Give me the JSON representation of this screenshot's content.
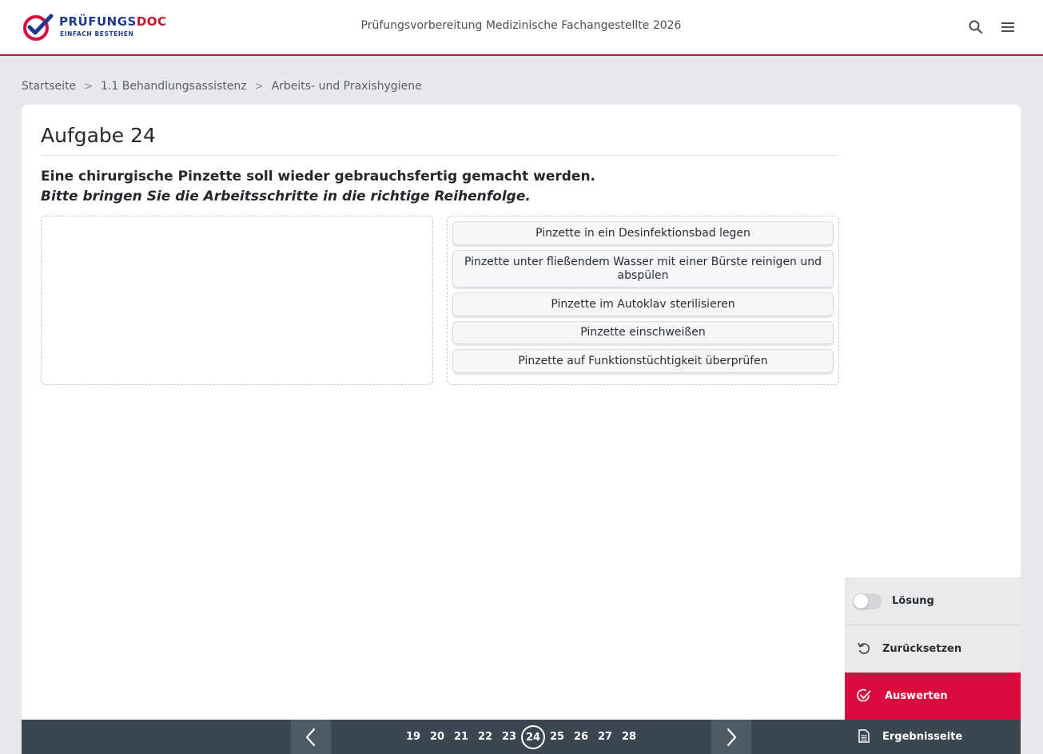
{
  "header": {
    "logo_brand_main": "PRÜFUNGS",
    "logo_brand_accent": "DOC",
    "logo_tagline": "EINFACH BESTEHEN",
    "title": "Prüfungsvorbereitung Medizinische Fachangestellte 2026",
    "icons": [
      "search-icon",
      "menu-icon"
    ]
  },
  "breadcrumb": [
    "Startseite",
    "1.1 Behandlungsassistenz",
    "Arbeits- und Praxishygiene"
  ],
  "task": {
    "title": "Aufgabe 24",
    "question": "Eine chirurgische Pinzette soll wieder gebrauchsfertig gemacht werden.",
    "instruction": "Bitte bringen Sie die Arbeitsschritte in die richtige Reihenfolge.",
    "items": [
      "Pinzette in ein Desinfektionsbad legen",
      "Pinzette unter fließendem Wasser mit einer Bürste reinigen und abspülen",
      "Pinzette im Autoklav sterilisieren",
      "Pinzette einschweißen",
      "Pinzette auf Funktionstüchtigkeit überprüfen"
    ]
  },
  "side_panel": {
    "solution_label": "Lösung",
    "solution_on": false,
    "reset_label": "Zurücksetzen",
    "evaluate_label": "Auswerten",
    "results_label": "Ergebnisseite"
  },
  "pagination": {
    "pages": [
      "19",
      "20",
      "21",
      "22",
      "23",
      "24",
      "25",
      "26",
      "27",
      "28"
    ],
    "current": "24"
  },
  "colors": {
    "accent": "#d90b3e",
    "brand_blue": "#1e3a8a",
    "dark_bar": "#3c4653"
  }
}
